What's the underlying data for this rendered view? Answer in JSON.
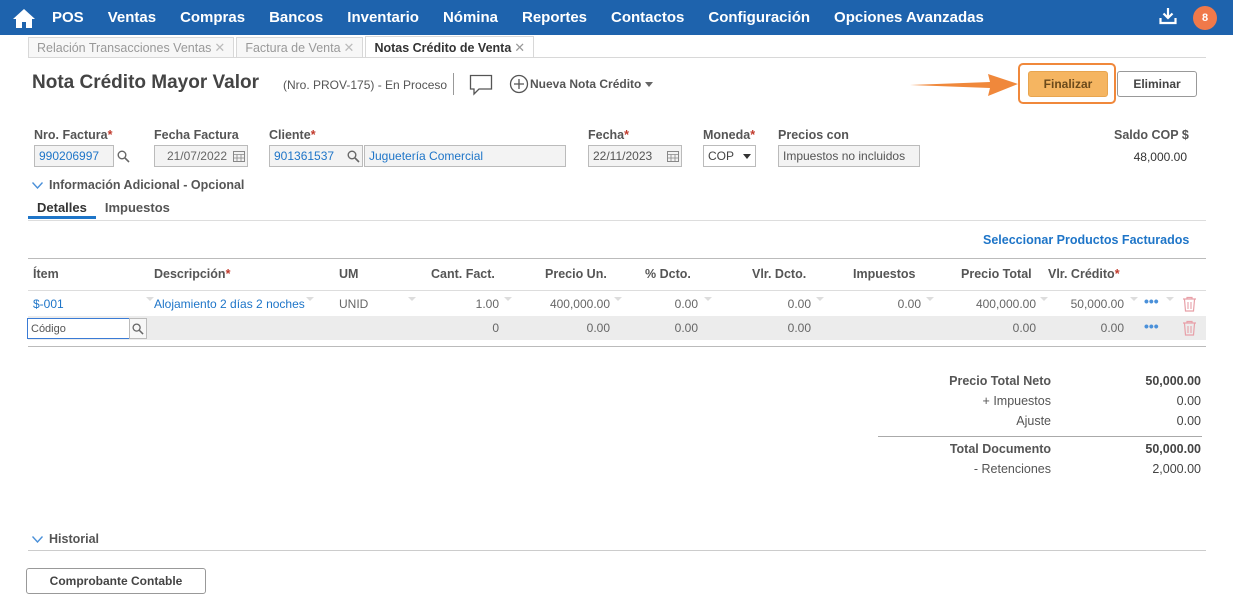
{
  "nav": {
    "items": [
      "POS",
      "Ventas",
      "Compras",
      "Bancos",
      "Inventario",
      "Nómina",
      "Reportes",
      "Contactos",
      "Configuración",
      "Opciones Avanzadas"
    ],
    "notifications": "8",
    "brand_color": "#1e63ad"
  },
  "tabs": [
    {
      "label": "Relación Transacciones Ventas",
      "active": false
    },
    {
      "label": "Factura de Venta",
      "active": false
    },
    {
      "label": "Notas Crédito de Venta",
      "active": true
    }
  ],
  "header": {
    "title": "Nota Crédito Mayor Valor",
    "subtitle": "(Nro. PROV-175) - En Proceso",
    "new_label": "Nueva Nota Crédito",
    "finalize": "Finalizar",
    "delete": "Eliminar"
  },
  "form": {
    "factura_label": "Nro. Factura",
    "factura_value": "990206997",
    "fecha_factura_label": "Fecha Factura",
    "fecha_factura_value": "21/07/2022",
    "cliente_label": "Cliente",
    "cliente_id": "901361537",
    "cliente_name": "Juguetería Comercial",
    "fecha_label": "Fecha",
    "fecha_value": "22/11/2023",
    "moneda_label": "Moneda",
    "moneda_value": "COP",
    "precios_label": "Precios con",
    "precios_value": "Impuestos no incluidos",
    "saldo_label": "Saldo COP $",
    "saldo_value": "48,000.00"
  },
  "info_adicional": "Información Adicional - Opcional",
  "subtabs": [
    "Detalles",
    "Impuestos"
  ],
  "select_products": "Seleccionar Productos Facturados",
  "grid": {
    "headers": [
      "Ítem",
      "Descripción",
      "UM",
      "Cant. Fact.",
      "Precio Un.",
      "% Dcto.",
      "Vlr. Dcto.",
      "Impuestos",
      "Precio Total",
      "Vlr. Crédito"
    ],
    "row1": {
      "item": "$-001",
      "descripcion": "Alojamiento 2 días 2 noches",
      "um": "UNID",
      "cant": "1.00",
      "precio_un": "400,000.00",
      "dcto_pct": "0.00",
      "dcto_vlr": "0.00",
      "impuestos": "0.00",
      "precio_total": "400,000.00",
      "vlr_credito": "50,000.00"
    },
    "row2": {
      "codigo_placeholder": "Código",
      "cant": "0",
      "precio_un": "0.00",
      "dcto_pct": "0.00",
      "dcto_vlr": "0.00",
      "precio_total": "0.00",
      "vlr_credito": "0.00"
    }
  },
  "totals": {
    "neto_label": "Precio Total Neto",
    "neto_value": "50,000.00",
    "impuestos_label": "+ Impuestos",
    "impuestos_value": "0.00",
    "ajuste_label": "Ajuste",
    "ajuste_value": "0.00",
    "total_label": "Total Documento",
    "total_value": "50,000.00",
    "retenciones_label": "- Retenciones",
    "retenciones_value": "2,000.00"
  },
  "historial": "Historial",
  "comprobante": "Comprobante Contable"
}
